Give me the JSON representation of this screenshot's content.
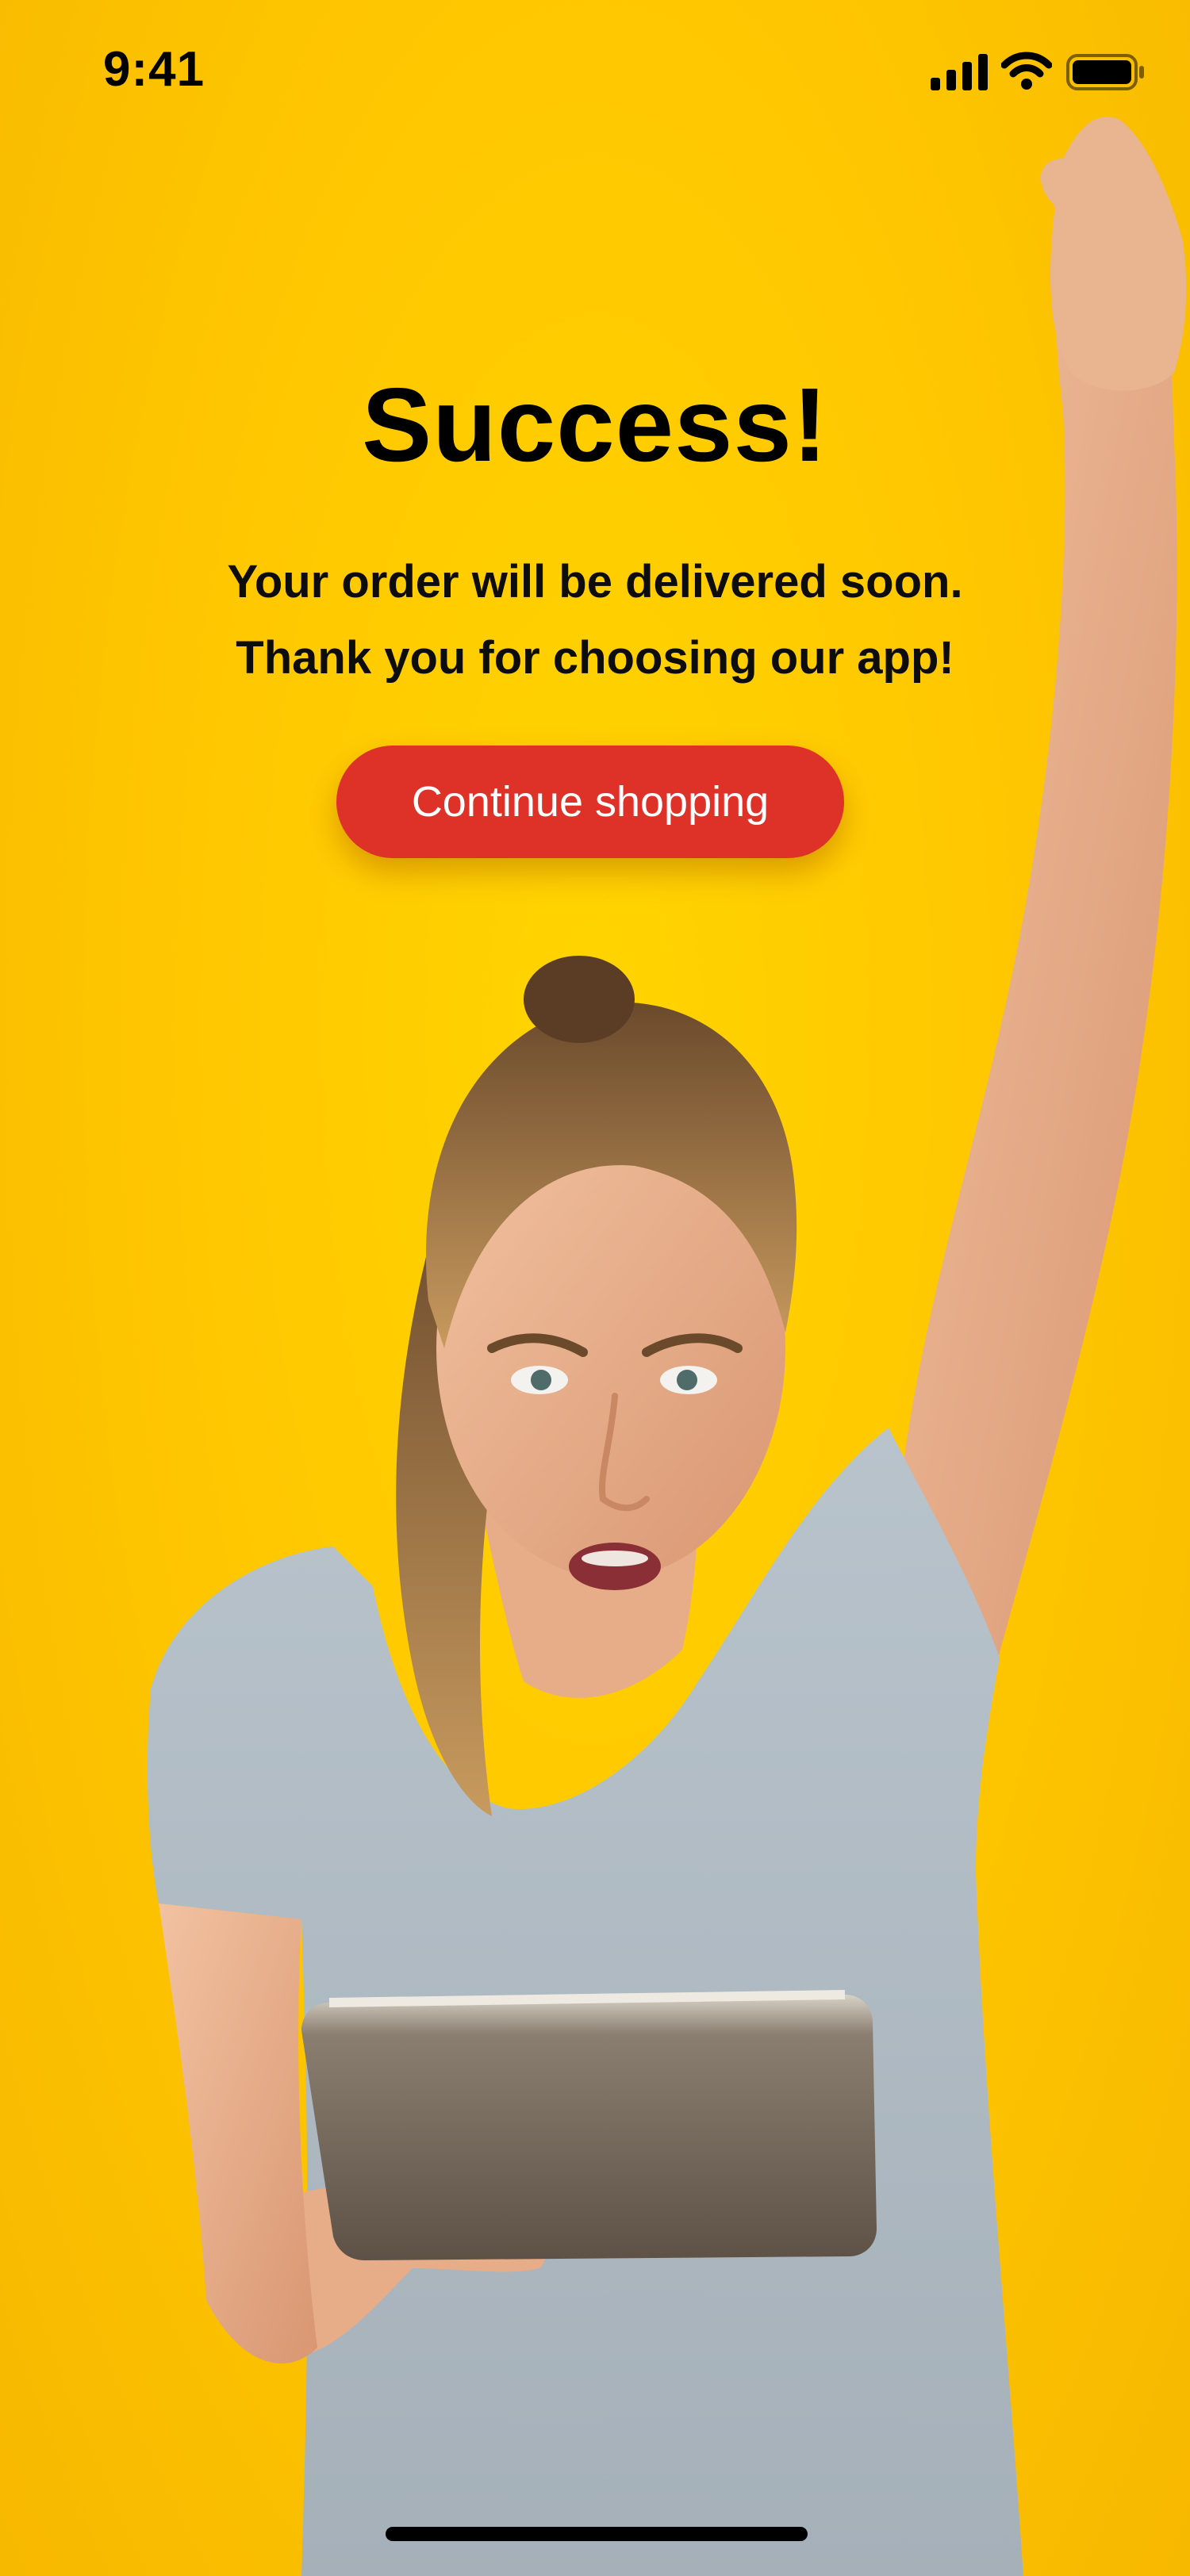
{
  "status_bar": {
    "time": "9:41",
    "icons": [
      "cellular-signal-icon",
      "wifi-icon",
      "battery-icon"
    ]
  },
  "success": {
    "title": "Success!",
    "message_line_1": "Your order will be delivered soon.",
    "message_line_2": "Thank you for choosing our app!",
    "button_label": "Continue shopping"
  },
  "colors": {
    "background": "#ffc800",
    "button": "#de3228",
    "button_text": "#ffffff",
    "text": "#000000"
  }
}
